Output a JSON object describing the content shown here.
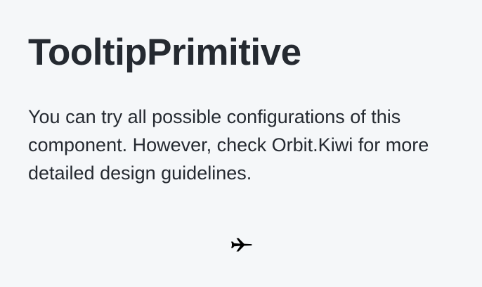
{
  "header": {
    "title": "TooltipPrimitive"
  },
  "main": {
    "description": "You can try all possible configurations of this component. However, check Orbit.Kiwi for more detailed design guidelines."
  },
  "tooltip_trigger": {
    "icon": "airplane-icon",
    "color": "#000000"
  },
  "colors": {
    "background": "#f5f7f9",
    "text": "#252a31"
  }
}
